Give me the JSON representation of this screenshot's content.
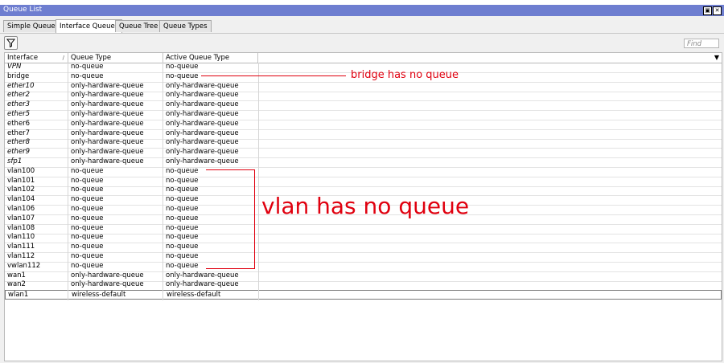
{
  "window": {
    "title": "Queue List"
  },
  "tabs": [
    {
      "label": "Simple Queues",
      "active": false
    },
    {
      "label": "Interface Queues",
      "active": true
    },
    {
      "label": "Queue Tree",
      "active": false
    },
    {
      "label": "Queue Types",
      "active": false
    }
  ],
  "toolbar": {
    "find_placeholder": "Find",
    "filter_icon": "filter-icon"
  },
  "table": {
    "columns": [
      "Interface",
      "Queue Type",
      "Active Queue Type"
    ],
    "rows": [
      {
        "interface": "VPN",
        "queue_type": "no-queue",
        "active": "no-queue",
        "italic": true
      },
      {
        "interface": "bridge",
        "queue_type": "no-queue",
        "active": "no-queue",
        "italic": false
      },
      {
        "interface": "ether10",
        "queue_type": "only-hardware-queue",
        "active": "only-hardware-queue",
        "italic": true
      },
      {
        "interface": "ether2",
        "queue_type": "only-hardware-queue",
        "active": "only-hardware-queue",
        "italic": true
      },
      {
        "interface": "ether3",
        "queue_type": "only-hardware-queue",
        "active": "only-hardware-queue",
        "italic": true
      },
      {
        "interface": "ether5",
        "queue_type": "only-hardware-queue",
        "active": "only-hardware-queue",
        "italic": true
      },
      {
        "interface": "ether6",
        "queue_type": "only-hardware-queue",
        "active": "only-hardware-queue",
        "italic": false
      },
      {
        "interface": "ether7",
        "queue_type": "only-hardware-queue",
        "active": "only-hardware-queue",
        "italic": false
      },
      {
        "interface": "ether8",
        "queue_type": "only-hardware-queue",
        "active": "only-hardware-queue",
        "italic": true
      },
      {
        "interface": "ether9",
        "queue_type": "only-hardware-queue",
        "active": "only-hardware-queue",
        "italic": true
      },
      {
        "interface": "sfp1",
        "queue_type": "only-hardware-queue",
        "active": "only-hardware-queue",
        "italic": true
      },
      {
        "interface": "vlan100",
        "queue_type": "no-queue",
        "active": "no-queue",
        "italic": false
      },
      {
        "interface": "vlan101",
        "queue_type": "no-queue",
        "active": "no-queue",
        "italic": false
      },
      {
        "interface": "vlan102",
        "queue_type": "no-queue",
        "active": "no-queue",
        "italic": false
      },
      {
        "interface": "vlan104",
        "queue_type": "no-queue",
        "active": "no-queue",
        "italic": false
      },
      {
        "interface": "vlan106",
        "queue_type": "no-queue",
        "active": "no-queue",
        "italic": false
      },
      {
        "interface": "vlan107",
        "queue_type": "no-queue",
        "active": "no-queue",
        "italic": false
      },
      {
        "interface": "vlan108",
        "queue_type": "no-queue",
        "active": "no-queue",
        "italic": false
      },
      {
        "interface": "vlan110",
        "queue_type": "no-queue",
        "active": "no-queue",
        "italic": false
      },
      {
        "interface": "vlan111",
        "queue_type": "no-queue",
        "active": "no-queue",
        "italic": false
      },
      {
        "interface": "vlan112",
        "queue_type": "no-queue",
        "active": "no-queue",
        "italic": false
      },
      {
        "interface": "vwlan112",
        "queue_type": "no-queue",
        "active": "no-queue",
        "italic": false
      },
      {
        "interface": "wan1",
        "queue_type": "only-hardware-queue",
        "active": "only-hardware-queue",
        "italic": false
      },
      {
        "interface": "wan2",
        "queue_type": "only-hardware-queue",
        "active": "only-hardware-queue",
        "italic": false
      },
      {
        "interface": "wlan1",
        "queue_type": "wireless-default",
        "active": "wireless-default",
        "italic": false
      }
    ]
  },
  "annotations": {
    "bridge_note": "bridge has no queue",
    "vlan_note": "vlan has no queue",
    "color": "#e0000f"
  }
}
